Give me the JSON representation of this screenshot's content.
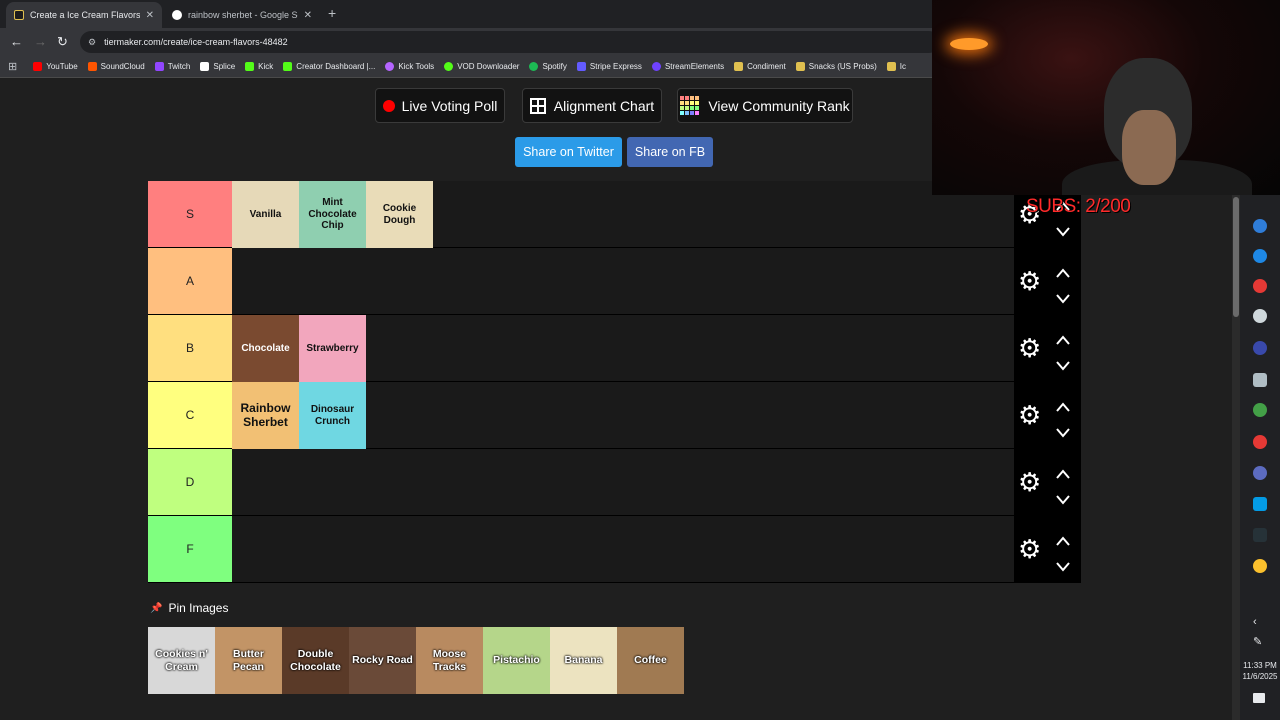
{
  "browser": {
    "tabs": [
      {
        "title": "Create a Ice Cream Flavors Tie",
        "active": true
      },
      {
        "title": "rainbow sherbet - Google Searc",
        "active": false
      }
    ],
    "new_tab": "+",
    "url": "tiermaker.com/create/ice-cream-flavors-48482",
    "bookmarks": [
      {
        "label": "YouTube",
        "color": "#ff0000"
      },
      {
        "label": "SoundCloud",
        "color": "#ff5500"
      },
      {
        "label": "Twitch",
        "color": "#9146ff"
      },
      {
        "label": "Splice",
        "color": "#ffffff"
      },
      {
        "label": "Kick",
        "color": "#53fc18"
      },
      {
        "label": "Creator Dashboard |...",
        "color": "#53fc18"
      },
      {
        "label": "Kick Tools",
        "color": "#b565ff"
      },
      {
        "label": "VOD Downloader",
        "color": "#53fc18"
      },
      {
        "label": "Spotify",
        "color": "#1db954"
      },
      {
        "label": "Stripe Express",
        "color": "#635bff"
      },
      {
        "label": "StreamElements",
        "color": "#6f42ff"
      },
      {
        "label": "Condiment",
        "color": "#e0c050"
      },
      {
        "label": "Snacks (US Probs)",
        "color": "#e0c050"
      },
      {
        "label": "Ic",
        "color": "#e0c050"
      }
    ]
  },
  "top_buttons": {
    "live_poll": "Live Voting Poll",
    "alignment": "Alignment Chart",
    "community": "View Community Rank"
  },
  "share": {
    "twitter": "Share on Twitter",
    "fb": "Share on FB"
  },
  "tiers": [
    {
      "label": "S",
      "color": "#ff7f7f",
      "items": [
        "Vanilla",
        "Mint Chocolate Chip",
        "Cookie Dough"
      ]
    },
    {
      "label": "A",
      "color": "#ffbf7f",
      "items": []
    },
    {
      "label": "B",
      "color": "#ffdf7f",
      "items": [
        "Chocolate",
        "Strawberry"
      ]
    },
    {
      "label": "C",
      "color": "#ffff7f",
      "items": [
        "Rainbow Sherbet",
        "Dinosaur Crunch"
      ]
    },
    {
      "label": "D",
      "color": "#bfff7f",
      "items": []
    },
    {
      "label": "F",
      "color": "#7fff7f",
      "items": []
    }
  ],
  "item_colors": {
    "Vanilla": "#e6d9b8",
    "Mint Chocolate Chip": "#8fcfb0",
    "Cookie Dough": "#e9dcb8",
    "Chocolate": "#7a4a30",
    "Strawberry": "#f2a6bd",
    "Rainbow Sherbet": "#f2c074",
    "Dinosaur Crunch": "#6fd7e2",
    "Cookies n' Cream": "#d8d8d8",
    "Butter Pecan": "#c29466",
    "Double Chocolate": "#5a3a28",
    "Rocky Road": "#6a4a38",
    "Moose Tracks": "#b88a60",
    "Pistachio": "#b5d68a",
    "Banana": "#ece3c0",
    "Coffee": "#a07a52"
  },
  "pin_label": "Pin Images",
  "pool": [
    "Cookies n' Cream",
    "Butter Pecan",
    "Double Chocolate",
    "Rocky Road",
    "Moose Tracks",
    "Pistachio",
    "Banana",
    "Coffee"
  ],
  "overlay": {
    "subs": "SUBS: 2/200"
  },
  "clock": {
    "time": "11:33 PM",
    "date": "11/6/2025"
  }
}
